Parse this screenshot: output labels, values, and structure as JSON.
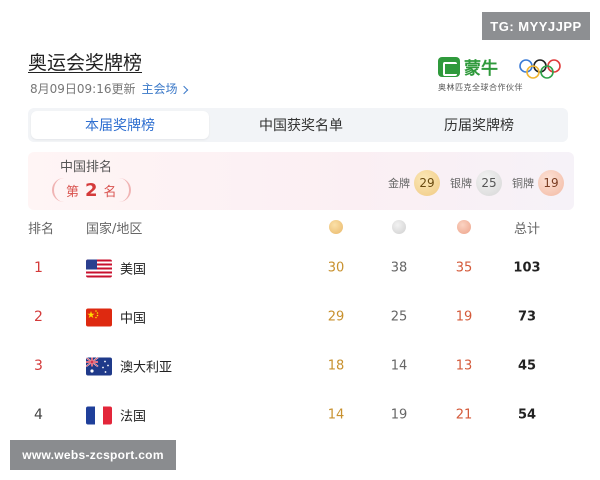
{
  "overlay": {
    "tg_tag": "TG: MYYJJPP",
    "watermark": "www.webs-zcsport.com"
  },
  "header": {
    "title": "奥运会奖牌榜",
    "updated": "8月09日09:16更新",
    "venue_link": "主会场"
  },
  "sponsor": {
    "brand": "蒙牛",
    "subtitle": "奥林匹克全球合作伙伴"
  },
  "tabs": [
    {
      "label": "本届奖牌榜",
      "active": true
    },
    {
      "label": "中国获奖名单",
      "active": false
    },
    {
      "label": "历届奖牌榜",
      "active": false
    }
  ],
  "china_summary": {
    "label": "中国排名",
    "rank_prefix": "第",
    "rank": "2",
    "rank_suffix": "名",
    "gold_label": "金牌",
    "gold": "29",
    "silver_label": "银牌",
    "silver": "25",
    "bronze_label": "铜牌",
    "bronze": "19"
  },
  "table": {
    "headers": {
      "rank": "排名",
      "country": "国家/地区",
      "total": "总计"
    },
    "rows": [
      {
        "rank": "1",
        "country": "美国",
        "flag": "us-flag",
        "gold": "30",
        "silver": "38",
        "bronze": "35",
        "total": "103"
      },
      {
        "rank": "2",
        "country": "中国",
        "flag": "cn-flag",
        "gold": "29",
        "silver": "25",
        "bronze": "19",
        "total": "73"
      },
      {
        "rank": "3",
        "country": "澳大利亚",
        "flag": "au-flag",
        "gold": "18",
        "silver": "14",
        "bronze": "13",
        "total": "45"
      },
      {
        "rank": "4",
        "country": "法国",
        "flag": "fr-flag",
        "gold": "14",
        "silver": "19",
        "bronze": "21",
        "total": "54"
      }
    ]
  },
  "colors": {
    "accent_blue": "#2f6fd0",
    "rank_red": "#d43a3a",
    "gold": "#c8912e",
    "bronze": "#d45a3a",
    "brand_green": "#2f9a3c"
  }
}
